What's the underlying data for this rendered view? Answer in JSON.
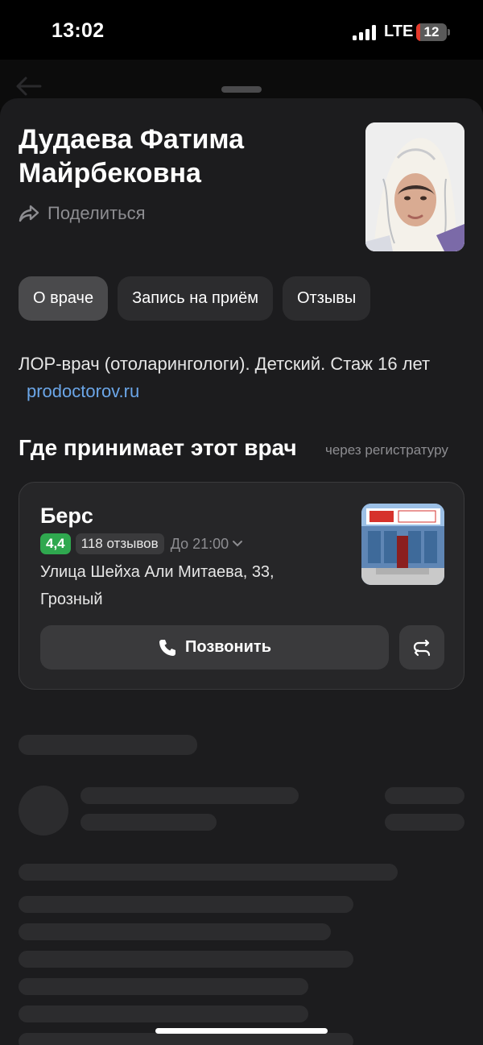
{
  "status_bar": {
    "time": "13:02",
    "network": "LTE",
    "battery": "12",
    "battery_level_percent": 12,
    "battery_low_color": "#e5392b"
  },
  "doctor": {
    "name": "Дудаева Фатима Майрбековна",
    "share_label": "Поделиться",
    "photo_icon": "doctor-portrait"
  },
  "tabs": [
    {
      "label": "О враче",
      "active": true
    },
    {
      "label": "Запись на приём",
      "active": false
    },
    {
      "label": "Отзывы",
      "active": false
    }
  ],
  "description": {
    "text": "ЛОР-врач (отоларингологи). Детский. Стаж 16 лет",
    "link": "prodoctorov.ru"
  },
  "where": {
    "title": "Где принимает этот врач",
    "subtitle": "через регистратуру"
  },
  "clinic": {
    "name": "Берс",
    "rating": "4,4",
    "reviews": "118 отзывов",
    "hours": "До 21:00",
    "address": "Улица Шейха Али Митаева, 33, Грозный",
    "call_label": "Позвонить",
    "route_icon": "route-icon",
    "rating_color": "#2fa84f"
  },
  "colors": {
    "background": "#1c1c1e",
    "link": "#6ba6e8",
    "secondary_text": "#8d8d91"
  }
}
